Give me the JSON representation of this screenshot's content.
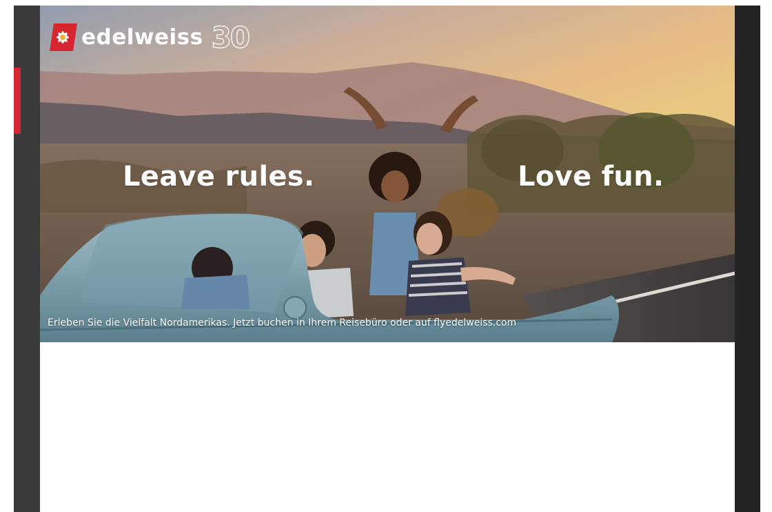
{
  "brand": {
    "name": "edelweiss",
    "anniversary": "30",
    "colors": {
      "primary": "#d6262f",
      "rail_dark": "#3a3a3a"
    },
    "logo_icon": "edelweiss-flower-icon"
  },
  "banner": {
    "headline_left": "Leave rules.",
    "headline_right": "Love fun.",
    "caption": "Erleben Sie die Vielfalt Nordamerikas. Jetzt buchen in Ihrem Reisebüro oder auf flyedelweiss.com",
    "image": "friends-in-convertible-desert-photo"
  }
}
